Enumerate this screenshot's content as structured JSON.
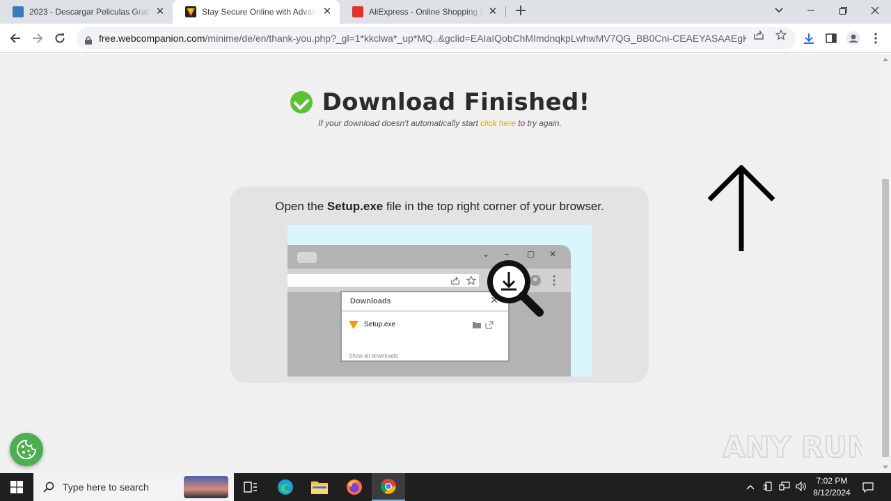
{
  "browser": {
    "tabs": [
      {
        "title": "2023 - Descargar Peliculas Gratis",
        "active": false,
        "favicon": "film-icon",
        "favicon_color": "#3a7bbf"
      },
      {
        "title": "Stay Secure Online with Advanced",
        "active": true,
        "favicon": "webcompanion-icon",
        "favicon_color": "#f59b00"
      },
      {
        "title": "AliExpress - Online Shopping für",
        "active": false,
        "favicon": "aliexpress-icon",
        "favicon_color": "#e43225"
      }
    ],
    "url_host": "free.webcompanion.com",
    "url_path": "/minime/de/en/thank-you.php?_gl=1*kkclwa*_up*MQ..&gclid=EAIaIQobChMImdnqkpLwhwMV7QG_BB0Cni-CEAEYASAAEgK..."
  },
  "page": {
    "title": "Download Finished!",
    "subtitle_pre": "If your download doesn't automatically start ",
    "subtitle_link": "click here",
    "subtitle_post": " to try again.",
    "instruction_pre": "Open the ",
    "instruction_bold": "Setup.exe",
    "instruction_post": " file in the top right corner of your browser.",
    "illustration": {
      "popup_title": "Downloads",
      "file_name": "Setup.exe",
      "show_all": "Show all downloads"
    },
    "accent_color": "#5bc236",
    "link_color": "#f5a300",
    "watermark": "ANY RUN"
  },
  "taskbar": {
    "search_placeholder": "Type here to search",
    "time": "7:02 PM",
    "date": "8/12/2024"
  }
}
